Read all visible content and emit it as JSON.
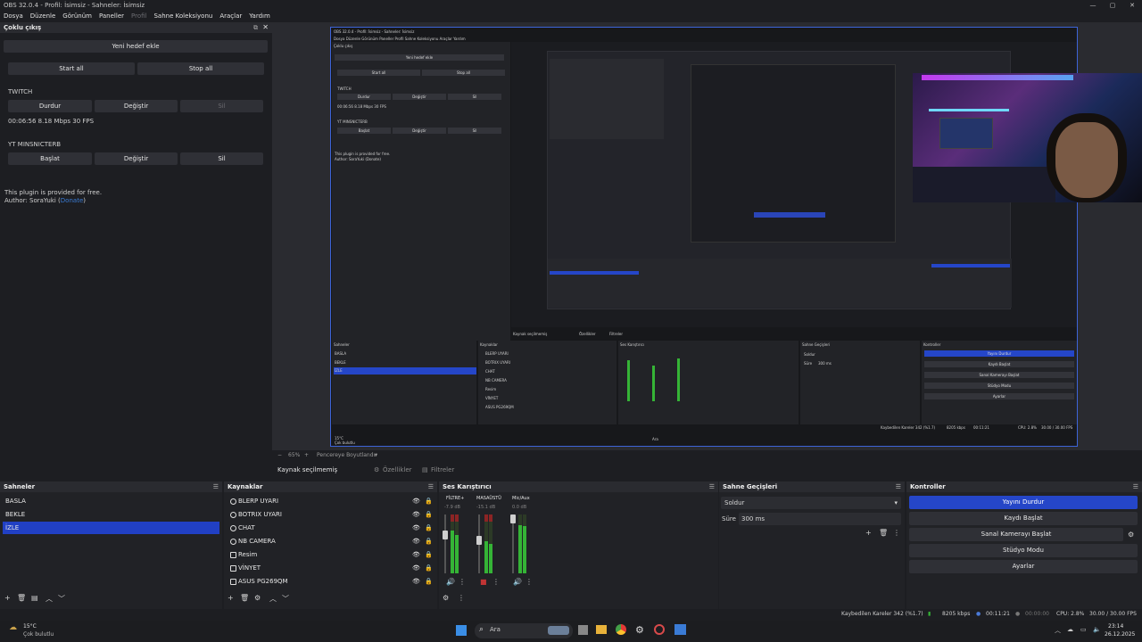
{
  "window": {
    "title": "OBS 32.0.4 - Profil: İsimsiz - Sahneler: İsimsiz",
    "controls": [
      "—",
      "▢",
      "✕"
    ]
  },
  "menu": [
    "Dosya",
    "Düzenle",
    "Görünüm",
    "Paneller",
    "Profil",
    "Sahne Koleksiyonu",
    "Araçlar",
    "Yardım"
  ],
  "multi_output": {
    "title": "Çoklu çıkış",
    "add_target": "Yeni hedef ekle",
    "start_all": "Start all",
    "stop_all": "Stop all",
    "targets": [
      {
        "name": "TWITCH",
        "btn_main": "Durdur",
        "btn_edit": "Değiştir",
        "btn_delete": "Sil",
        "stats": "00:06:56  8.18 Mbps  30 FPS"
      },
      {
        "name": "YT MINSNICTERB",
        "btn_main": "Başlat",
        "btn_edit": "Değiştir",
        "btn_delete": "Sil",
        "stats": ""
      }
    ],
    "plugin_note": "This plugin is provided for free.",
    "author_prefix": "Author: SoraYuki (",
    "author_link": "Donate",
    "author_suffix": ")"
  },
  "preview": {
    "zoom": "65%",
    "scale_label": "Pencereye Boyutlandır"
  },
  "context": {
    "source_label": "Kaynak seçilmemiş",
    "properties": "Özellikler",
    "filters": "Filtreler"
  },
  "scenes_dock": {
    "title": "Sahneler",
    "items": [
      "BASLA",
      "BEKLE",
      "İZLE"
    ],
    "selected": 2
  },
  "sources_dock": {
    "title": "Kaynaklar",
    "items": [
      "BLERP UYARI",
      "BOTRIX UYARI",
      "CHAT",
      "NB CAMERA",
      "Resim",
      "VİNYET",
      "ASUS PG269QM"
    ]
  },
  "mixer_dock": {
    "title": "Ses Karıştırıcı",
    "channels": [
      {
        "name": "FİLTRE+",
        "db": "-7.9 dB",
        "level": 0.72,
        "fader": 0.6
      },
      {
        "name": "MASAÜSTÜ",
        "db": "-15.1 dB",
        "level": 0.55,
        "fader": 0.55
      },
      {
        "name": "Mic/Aux",
        "db": "0.0 dB",
        "level": 0.82,
        "fader": 0.95
      }
    ],
    "scale": [
      "0",
      "-5",
      "-10",
      "-15",
      "-20",
      "-25",
      "-30",
      "-35",
      "-40",
      "-45",
      "-50",
      "-55",
      "-60"
    ]
  },
  "transitions_dock": {
    "title": "Sahne Geçişleri",
    "transition": "Soldur",
    "duration_label": "Süre",
    "duration_value": "300 ms"
  },
  "controls_dock": {
    "title": "Kontroller",
    "stop_stream": "Yayını Durdur",
    "start_record": "Kaydı Başlat",
    "start_vcam": "Sanal Kamerayı Başlat",
    "studio_mode": "Stüdyo Modu",
    "settings": "Ayarlar"
  },
  "status": {
    "dropped": "Kaybedilen Kareler 342 (%1.7)",
    "bitrate": "8205 kbps",
    "stream_time": "00:11:21",
    "rec_time": "00:00:00",
    "cpu": "CPU: 2.8%",
    "fps": "30.00 / 30.00 FPS"
  },
  "taskbar": {
    "weather_temp": "15°C",
    "weather_desc": "Çok bulutlu",
    "search": "Ara",
    "time": "23:14",
    "date": "26.12.2025"
  },
  "nested": {
    "title": "OBS 32.0.4 - Profil: İsimsiz - Sahneler: İsimsiz",
    "menu": "Dosya  Düzenle  Görünüm  Paneller  Profil  Sahne Koleksiyonu  Araçlar  Yardım",
    "dock_title": "Çoklu çıkış",
    "add": "Yeni hedef ekle",
    "start": "Start all",
    "stop": "Stop all",
    "twitch": "TWITCH",
    "durdur": "Durdur",
    "degistir": "Değiştir",
    "sil": "Sil",
    "stats": "00:06:56  8.18 Mbps  30 FPS",
    "yt": "YT MINSNICTERB",
    "baslat": "Başlat",
    "note": "This plugin is provided for free.",
    "author": "Author: SoraYuki (Donate)",
    "ctx": "Kaynak seçilmemiş",
    "props": "Özellikler",
    "filters": "Filtreler",
    "scenes": "Sahneler",
    "sources": "Kaynaklar",
    "mixer": "Ses Karıştırıcı",
    "trans": "Sahne Geçişleri",
    "ctrl": "Kontroller",
    "scene_items": [
      "BASLA",
      "BEKLE",
      "İZLE"
    ],
    "source_items": [
      "BLERP UYARI",
      "BOTRIX UYARI",
      "CHAT",
      "NB CAMERA",
      "Resim",
      "VİNYET",
      "ASUS PG269QM"
    ],
    "ctrl_items": [
      "Yayını Durdur",
      "Kaydı Başlat",
      "Sanal Kamerayı Başlat",
      "Stüdyo Modu",
      "Ayarlar"
    ],
    "soldur": "Soldur",
    "sure": "Süre",
    "ms": "300 ms",
    "status": "Kaybedilen Kareler 342 (%1.7)",
    "kbps": "8205 kbps",
    "time": "00:11:21",
    "cpu": "CPU: 2.8%",
    "fps": "30.00 / 30.00 FPS",
    "temp": "15°C",
    "weather": "Çok bulutlu",
    "search": "Ara"
  }
}
